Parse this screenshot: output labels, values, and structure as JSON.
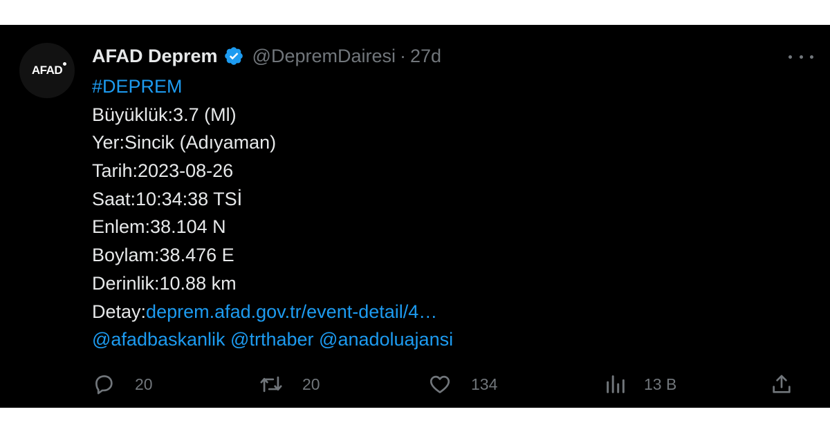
{
  "tweet": {
    "avatar_text": "AFAD",
    "display_name": "AFAD Deprem",
    "handle": "@DepremDairesi",
    "separator": "·",
    "time": "27d",
    "lines": {
      "hashtag": "#DEPREM",
      "magnitude": "Büyüklük:3.7 (Ml)",
      "location": "Yer:Sincik (Adıyaman)",
      "date": "Tarih:2023-08-26",
      "time": "Saat:10:34:38 TSİ",
      "latitude": "Enlem:38.104 N",
      "longitude": "Boylam:38.476 E",
      "depth": "Derinlik:10.88 km",
      "detail_label": "Detay:",
      "detail_link": "deprem.afad.gov.tr/event-detail/4…",
      "mentions": [
        "@afadbaskanlik",
        "@trthaber",
        "@anadoluajansi"
      ]
    },
    "actions": {
      "replies": "20",
      "retweets": "20",
      "likes": "134",
      "views": "13 B"
    }
  },
  "icons": {
    "verified": "verified-badge-icon",
    "more": "more-dots-icon",
    "reply": "reply-bubble-icon",
    "retweet": "retweet-arrows-icon",
    "like": "heart-icon",
    "views": "bar-chart-icon",
    "share": "share-upload-icon"
  },
  "colors": {
    "background": "#000000",
    "text": "#e7e9ea",
    "muted": "#71767b",
    "link": "#1d9bf0"
  }
}
